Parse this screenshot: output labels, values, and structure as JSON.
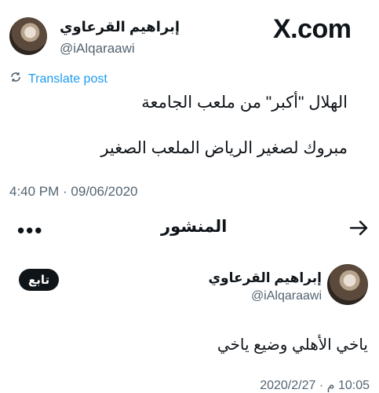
{
  "top_post": {
    "display_name": "إبراهيم القرعاوي",
    "handle": "@iAlqaraawi",
    "brand": "X.com",
    "translate_label": "Translate post",
    "lines": [
      "الهلال \"أكبر\" من ملعب الجامعة",
      "مبروك لصغير الرياض الملعب الصغير"
    ],
    "timestamp": "4:40 PM · 09/06/2020"
  },
  "toolbar": {
    "title": "المنشور",
    "more_label": "•••"
  },
  "bottom_post": {
    "display_name": "إبراهيم القرعاوي",
    "handle": "@iAlqaraawi",
    "follow_label": "تابع",
    "text": "ياخي الأهلي وضيع ياخي",
    "timestamp": "10:05 م · 2020/2/27"
  },
  "colors": {
    "link": "#1d9bf0",
    "muted": "#536471",
    "text": "#0f1419"
  }
}
